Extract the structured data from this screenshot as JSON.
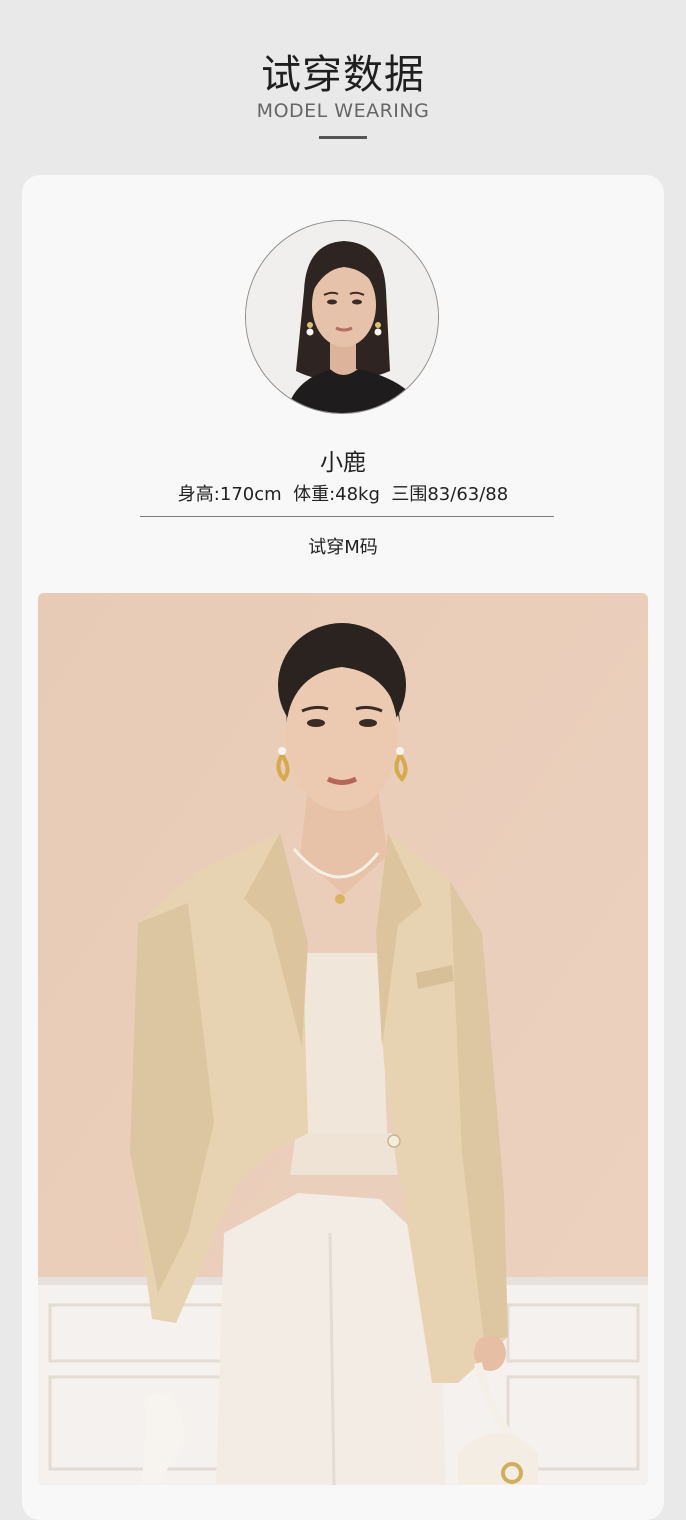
{
  "header": {
    "title": "试穿数据",
    "subtitle": "MODEL WEARING"
  },
  "model": {
    "name": "小鹿",
    "stats": "身高:170cm  体重:48kg  三围83/63/88",
    "size_tried": "试穿M码"
  },
  "colors": {
    "page_background": "#e9e9e9",
    "card_background": "#f8f8f8",
    "photo_background": "#e9cdb9",
    "blazer": "#e7d3b1"
  }
}
